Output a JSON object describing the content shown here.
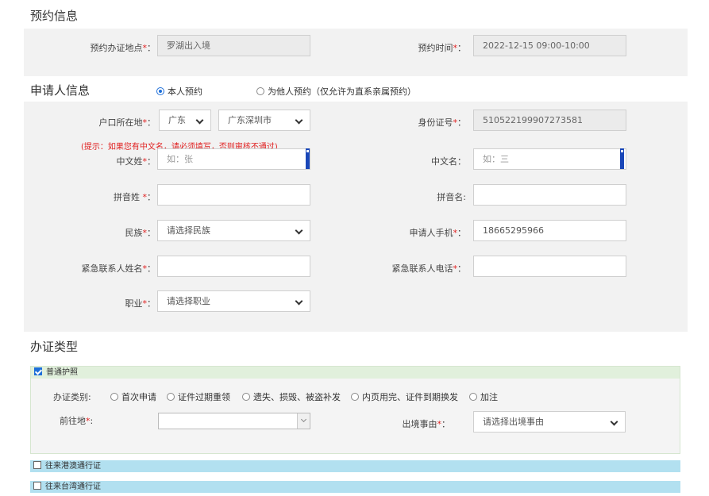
{
  "appointment": {
    "title": "预约信息",
    "location_label": "预约办证地点",
    "location_value": "罗湖出入境",
    "time_label": "预约时间",
    "time_value": "2022-12-15 09:00-10:00"
  },
  "applicant": {
    "title": "申请人信息",
    "radio_self": "本人预约",
    "radio_other": "为他人预约（仅允许为直系亲属预约）",
    "hukou_label": "户口所在地",
    "hukou_province": "广东",
    "hukou_city": "广东深圳市",
    "id_label": "身份证号",
    "id_value": "510522199907273581",
    "hint": "(提示：如果您有中文名，请必须填写，否则审核不通过)",
    "surname_label": "中文姓",
    "surname_placeholder": "如：张",
    "givenname_label": "中文名：",
    "givenname_placeholder": "如：三",
    "pinyin_surname_label": "拼音姓 ",
    "pinyin_given_label": "拼音名:",
    "ethnicity_label": "民族",
    "ethnicity_value": "请选择民族",
    "phone_label": "申请人手机",
    "phone_value": "18665295966",
    "emergency_name_label": "紧急联系人姓名",
    "emergency_phone_label": "紧急联系人电话",
    "occupation_label": "职业",
    "occupation_value": "请选择职业",
    "required_mark": "*",
    "colon": ":",
    "colon_cn": "："
  },
  "cert_type": {
    "title": "办证类型",
    "passport_label": "普通护照",
    "category_label": "办证类别:",
    "options": [
      "首次申请",
      "证件过期重领",
      "遗失、损毁、被盗补发",
      "内页用完、证件到期换发",
      "加注"
    ],
    "destination_label": "前往地",
    "reason_label": "出境事由",
    "reason_value": "请选择出境事由",
    "hk_macau_label": "往来港澳通行证",
    "taiwan_label": "往来台湾通行证"
  },
  "colors": {
    "required": "#e02020",
    "selected_section": "#e1f0dc",
    "collapsed_section": "#b2e0f0",
    "panel": "#f2f2f2"
  }
}
